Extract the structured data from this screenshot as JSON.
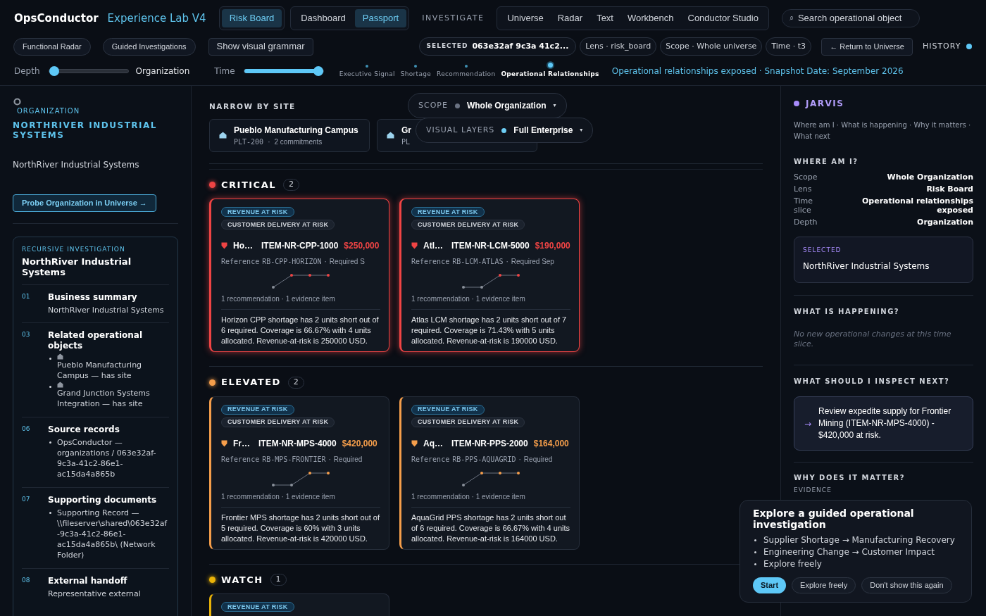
{
  "header": {
    "brand": "OpsConductor",
    "product": "Experience Lab V4",
    "nav_groups": [
      [
        {
          "label": "Risk Board",
          "selected": true
        }
      ],
      [
        {
          "label": "Dashboard",
          "selected": false
        },
        {
          "label": "Passport",
          "selected": true
        }
      ]
    ],
    "investigate_label": "INVESTIGATE",
    "investigate_items": [
      {
        "label": "Universe",
        "selected": false
      },
      {
        "label": "Radar",
        "selected": false
      },
      {
        "label": "Text",
        "selected": false
      },
      {
        "label": "Workbench",
        "selected": false
      },
      {
        "label": "Conductor Studio",
        "selected": false
      }
    ],
    "search": {
      "icon": "⌕",
      "placeholder": "Search operational object"
    }
  },
  "toolbar": {
    "chips": [
      "Functional Radar",
      "Guided Investigations"
    ],
    "grammar_button": "Show visual grammar",
    "selected_chip": {
      "label": "SELECTED",
      "value": "063e32af 9c3a 41c2..."
    },
    "context_chips": [
      "Lens · risk_board",
      "Scope · Whole universe",
      "Time · t3"
    ],
    "return_button": "← Return to Universe",
    "history": {
      "label": "HISTORY",
      "active": true
    }
  },
  "controls": {
    "depth": {
      "label": "Depth",
      "level": 0,
      "value": "Organization"
    },
    "time": {
      "label": "Time",
      "level": 1
    },
    "timeline": [
      {
        "label": "Executive Signal",
        "selected": false
      },
      {
        "label": "Shortage",
        "selected": false
      },
      {
        "label": "Recommendation",
        "selected": false
      },
      {
        "label": "Operational Relationships",
        "selected": true
      }
    ],
    "status": "Operational relationships exposed · Snapshot Date: September 2026"
  },
  "sidebar": {
    "kind_label": "ORGANIZATION",
    "title": "NORTHRIVER INDUSTRIAL SYSTEMS",
    "name": "NorthRiver Industrial Systems",
    "probe_button": "Probe Organization in Universe →",
    "investigation": {
      "label": "RECURSIVE INVESTIGATION",
      "title": "NorthRiver Industrial Systems",
      "sections": [
        {
          "number": "01",
          "title": "Business summary",
          "text": "NorthRiver Industrial Systems"
        },
        {
          "number": "03",
          "title": "Related operational objects",
          "items": [
            {
              "kind": "object",
              "text": "Pueblo Manufacturing Campus — has site"
            },
            {
              "kind": "object",
              "text": "Grand Junction Systems Integration — has site"
            }
          ]
        },
        {
          "number": "06",
          "title": "Source records",
          "items": [
            {
              "kind": "record",
              "text": "OpsConductor — organizations / 063e32af-9c3a-41c2-86e1-ac15da4a865b"
            }
          ]
        },
        {
          "number": "07",
          "title": "Supporting documents",
          "items": [
            {
              "kind": "record",
              "text": "Supporting Record — \\\\fileserver\\shared\\063e32af-9c3a-41c2-86e1-ac15da4a865b\\ (Network Folder)"
            }
          ]
        },
        {
          "number": "08",
          "title": "External handoff",
          "text": "Representative external"
        }
      ]
    }
  },
  "center": {
    "narrow_label": "NARROW BY SITE",
    "sites": [
      {
        "name": "Pueblo Manufacturing Campus",
        "code": "PLT-200",
        "separator": "·",
        "commitments": "2 commitments"
      },
      {
        "name": "Gr",
        "code": "PL"
      }
    ],
    "scope": {
      "label": "SCOPE",
      "value": "Whole Organization",
      "caret": "▾"
    },
    "layers": {
      "label": "VISUAL LAYERS",
      "value": "Full Enterprise",
      "caret": "▾"
    },
    "sections": [
      {
        "label": "CRITICAL",
        "count": "2",
        "color": "#ef4444",
        "glow": true,
        "cards": [
          {
            "tags": [
              {
                "kind": "revenue",
                "label": "REVENUE AT RISK"
              },
              {
                "kind": "delivery",
                "label": "CUSTOMER DELIVERY AT RISK"
              }
            ],
            "name": "Ho…",
            "item": "ITEM-NR-CPP-1000",
            "amount": "$250,000",
            "reference_label": "Reference",
            "reference": "RB-CPP-HORIZON",
            "separator": "·",
            "required": "Required S",
            "counts": "1 recommendation · 1 evidence item",
            "summary": "Horizon CPP shortage has 2 units short out of 6 required. Coverage is 66.67% with 4 units allocated. Revenue-at-risk is 250000 USD."
          },
          {
            "tags": [
              {
                "kind": "revenue",
                "label": "REVENUE AT RISK"
              },
              {
                "kind": "delivery",
                "label": "CUSTOMER DELIVERY AT RISK"
              }
            ],
            "name": "Atl…",
            "item": "ITEM-NR-LCM-5000",
            "amount": "$190,000",
            "reference_label": "Reference",
            "reference": "RB-LCM-ATLAS",
            "separator": "·",
            "required": "Required Sep",
            "counts": "1 recommendation · 1 evidence item",
            "summary": "Atlas LCM shortage has 2 units short out of 7 required. Coverage is 71.43% with 5 units allocated. Revenue-at-risk is 190000 USD."
          }
        ]
      },
      {
        "label": "ELEVATED",
        "count": "2",
        "color": "#f59e4b",
        "glow": false,
        "cards": [
          {
            "tags": [
              {
                "kind": "revenue",
                "label": "REVENUE AT RISK"
              },
              {
                "kind": "delivery",
                "label": "CUSTOMER DELIVERY AT RISK"
              }
            ],
            "name": "Fr…",
            "item": "ITEM-NR-MPS-4000",
            "amount": "$420,000",
            "reference_label": "Reference",
            "reference": "RB-MPS-FRONTIER",
            "separator": "·",
            "required": "Required",
            "counts": "1 recommendation · 1 evidence item",
            "summary": "Frontier MPS shortage has 2 units short out of 5 required. Coverage is 60% with 3 units allocated. Revenue-at-risk is 420000 USD."
          },
          {
            "tags": [
              {
                "kind": "revenue",
                "label": "REVENUE AT RISK"
              },
              {
                "kind": "delivery",
                "label": "CUSTOMER DELIVERY AT RISK"
              }
            ],
            "name": "Aq…",
            "item": "ITEM-NR-PPS-2000",
            "amount": "$164,000",
            "reference_label": "Reference",
            "reference": "RB-PPS-AQUAGRID",
            "separator": "·",
            "required": "Required",
            "counts": "1 recommendation · 1 evidence item",
            "summary": "AquaGrid PPS shortage has 2 units short out of 6 required. Coverage is 66.67% with 4 units allocated. Revenue-at-risk is 164000 USD."
          }
        ]
      },
      {
        "label": "WATCH",
        "count": "1",
        "color": "#eab308",
        "glow": false,
        "cards": [
          {
            "tags": [
              {
                "kind": "revenue",
                "label": "REVENUE AT RISK"
              }
            ]
          }
        ]
      }
    ]
  },
  "assistant": {
    "name": "JARVIS",
    "subtitle": "Where am I · What is happening · Why it matters · What next",
    "where_label": "WHERE AM I?",
    "facts": [
      {
        "key": "Scope",
        "value": "Whole Organization"
      },
      {
        "key": "Lens",
        "value": "Risk Board"
      },
      {
        "key": "Time slice",
        "value": "Operational relationships exposed"
      },
      {
        "key": "Depth",
        "value": "Organization"
      }
    ],
    "selected": {
      "label": "SELECTED",
      "value": "NorthRiver Industrial Systems"
    },
    "happening_label": "WHAT IS HAPPENING?",
    "happening_text": "No new operational changes at this time slice.",
    "next_label": "WHAT SHOULD I INSPECT NEXT?",
    "next": {
      "arrow": "→",
      "text": "Review expedite supply for Frontier Mining (ITEM-NR-MPS-4000) - $420,000 at risk."
    },
    "why_label": "WHY DOES IT MATTER?",
    "evidence_label": "EVIDENCE"
  },
  "guide": {
    "title": "Explore a guided operational investigation",
    "items": [
      "Supplier Shortage → Manufacturing Recovery",
      "Engineering Change → Customer Impact",
      "Explore freely"
    ],
    "buttons": [
      {
        "label": "Start",
        "selected": true
      },
      {
        "label": "Explore freely",
        "selected": false
      },
      {
        "label": "Don't show this again",
        "selected": false
      }
    ]
  }
}
